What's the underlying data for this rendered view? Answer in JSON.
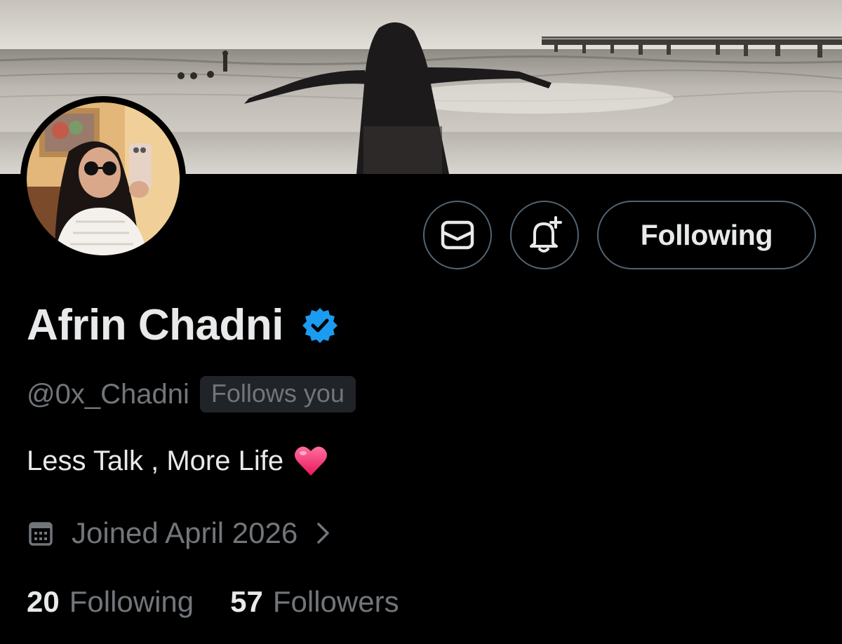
{
  "profile": {
    "name": "Afrin Chadni",
    "handle": "@0x_Chadni",
    "follows_you": "Follows you",
    "bio": "Less Talk , More Life",
    "joined": "Joined April 2026",
    "verified": true
  },
  "actions": {
    "following_label": "Following",
    "message_icon": "mail-icon",
    "notify_icon": "bell-plus-icon"
  },
  "stats": {
    "following_count": "20",
    "following_label": "Following",
    "followers_count": "57",
    "followers_label": "Followers"
  },
  "colors": {
    "background": "#000000",
    "primary_text": "#e7e9ea",
    "secondary_text": "#71767b",
    "verified_blue": "#1d9bf0",
    "button_border": "#536471",
    "badge_bg": "#202327",
    "heart": "#f91880"
  }
}
